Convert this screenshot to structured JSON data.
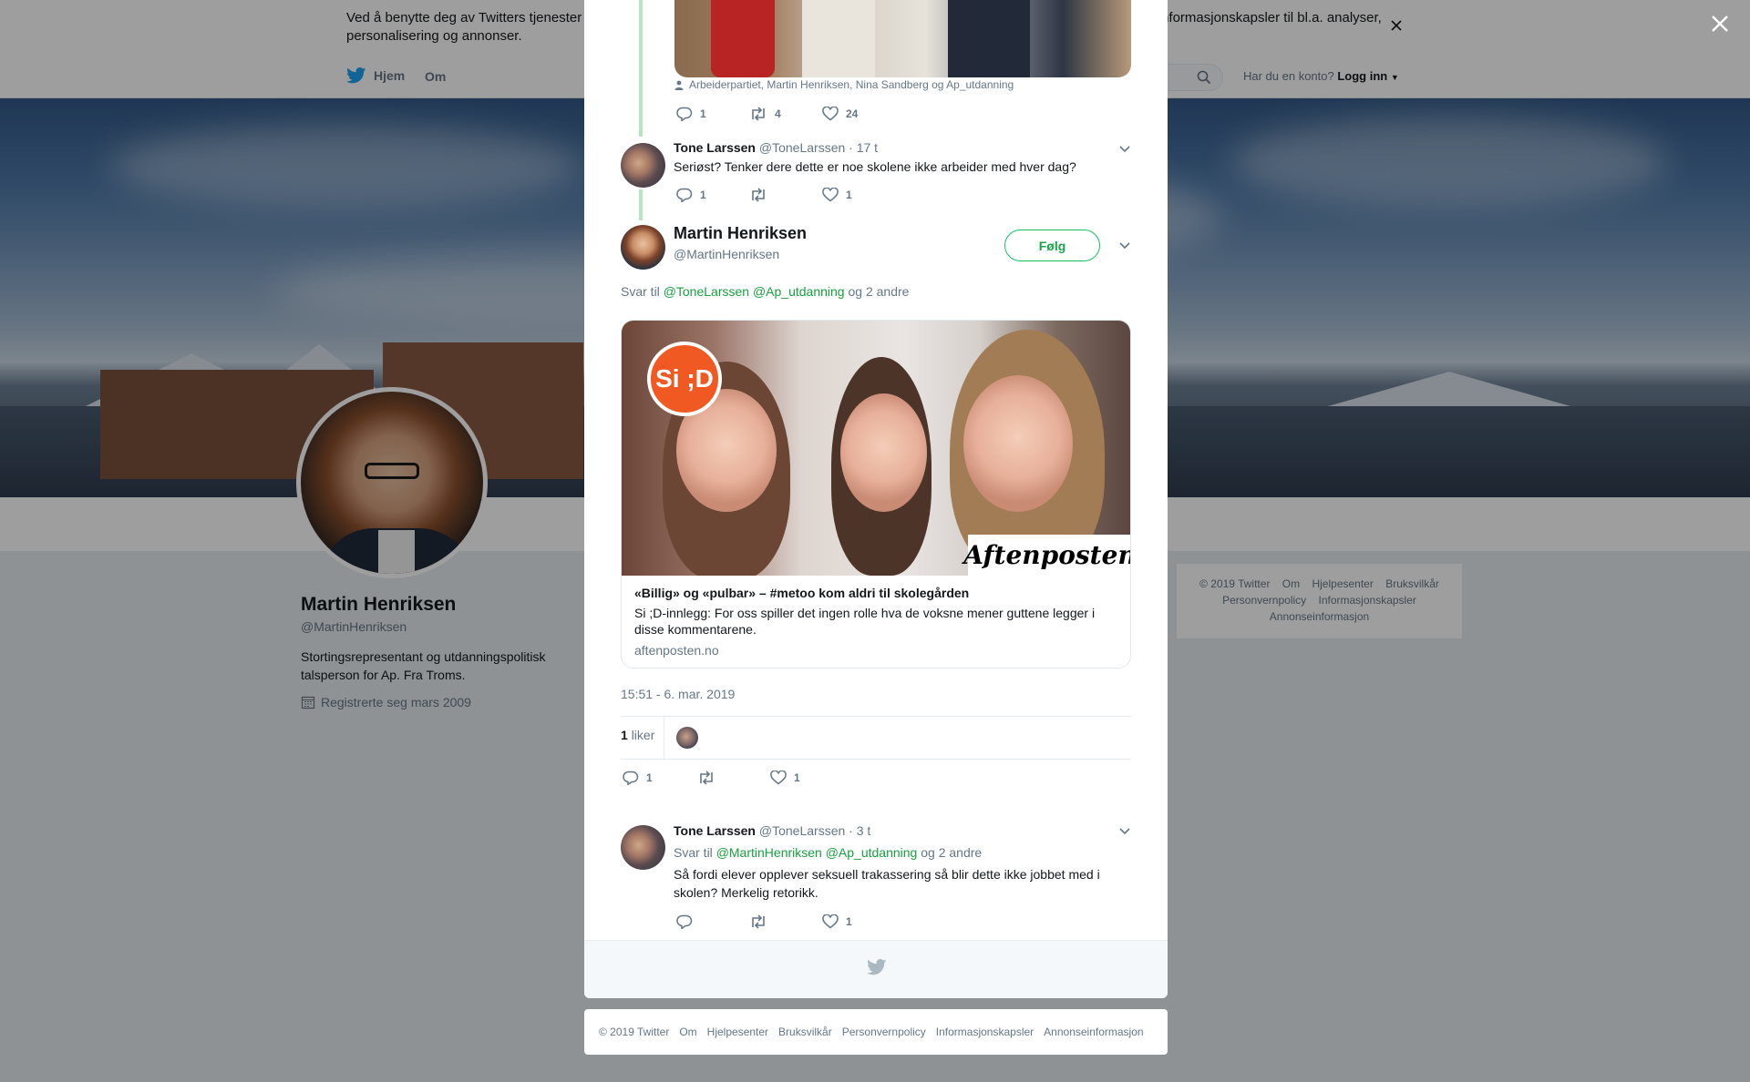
{
  "cookie_banner": {
    "text": "Ved å benytte deg av Twitters tjenester samtykker du i vår bruk av informasjonskapsler. Vi og våre partnere opererer globalt og bruker informasjonskapsler til bl.a. analyser, personalisering og annonser."
  },
  "topnav": {
    "home_label": "Hjem",
    "about_label": "Om",
    "login_prompt": "Har du en konto?",
    "login_label": "Logg inn"
  },
  "profile": {
    "name": "Martin Henriksen",
    "handle": "@MartinHenriksen",
    "bio": "Stortingsrepresentant og utdanningspolitisk talsperson for Ap. Fra Troms.",
    "joined": "Registrerte seg mars 2009"
  },
  "side_footer": {
    "links": [
      "© 2019 Twitter",
      "Om",
      "Hjelpesenter",
      "Bruksvilkår",
      "Personvernpolicy",
      "Informasjonskapsler",
      "Annonseinformasjon"
    ]
  },
  "modal": {
    "top_tweet": {
      "tagged": "Arbeiderpartiet, Martin Henriksen, Nina Sandberg og Ap_utdanning",
      "replies": "1",
      "retweets": "4",
      "likes": "24"
    },
    "reply_1": {
      "name": "Tone Larssen",
      "handle": "@ToneLarssen",
      "time": "· 17 t",
      "text": "Seriøst? Tenker dere dette er noe skolene ikke arbeider med hver dag?",
      "replies": "1",
      "retweets": "",
      "likes": "1"
    },
    "main_tweet": {
      "name": "Martin Henriksen",
      "handle": "@MartinHenriksen",
      "follow_label": "Følg",
      "reply_prefix": "Svar til",
      "reply_mention_1": "@ToneLarssen",
      "reply_mention_2": "@Ap_utdanning",
      "reply_suffix": "og 2 andre",
      "card": {
        "badge": "Si ;D",
        "publisher_logo": "Aftenposten",
        "title": "«Billig» og «pulbar» – #metoo kom aldri til skolegården",
        "description": "Si ;D-innlegg: For oss spiller det ingen rolle hva de voksne mener guttene legger i disse kommentarene.",
        "domain": "aftenposten.no"
      },
      "timestamp": "15:51 - 6. mar. 2019",
      "likes_number": "1",
      "likes_word": "liker",
      "replies": "1",
      "retweets": "",
      "likes": "1"
    },
    "reply_2": {
      "name": "Tone Larssen",
      "handle": "@ToneLarssen",
      "time": "· 3 t",
      "reply_prefix": "Svar til",
      "reply_mention_1": "@MartinHenriksen",
      "reply_mention_2": "@Ap_utdanning",
      "reply_suffix": "og 2 andre",
      "text": "Så fordi elever opplever seksuell trakassering så blir dette ikke jobbet med i skolen? Merkelig retorikk.",
      "replies": "",
      "retweets": "",
      "likes": "1"
    }
  },
  "modal_footer": {
    "links": [
      "© 2019 Twitter",
      "Om",
      "Hjelpesenter",
      "Bruksvilkår",
      "Personvernpolicy",
      "Informasjonskapsler",
      "Annonseinformasjon"
    ]
  },
  "colors": {
    "accent_green": "#17a03e",
    "twitter_blue": "#1da1f2",
    "thread_line": "#b8e5c0"
  }
}
